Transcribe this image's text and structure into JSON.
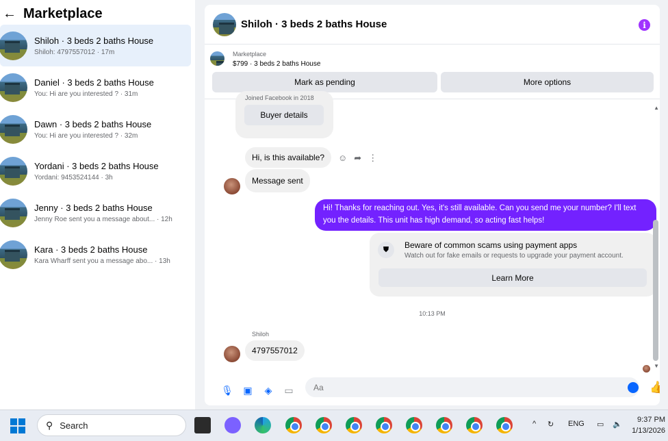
{
  "sidebar": {
    "title": "Marketplace",
    "conversations": [
      {
        "title": "Shiloh · 3 beds 2 baths House",
        "preview": "Shiloh: 4797557012 · 17m"
      },
      {
        "title": "Daniel · 3 beds 2 baths House",
        "preview": "You: Hi are you interested ? · 31m"
      },
      {
        "title": "Dawn · 3 beds 2 baths House",
        "preview": "You: Hi are you interested ? · 32m"
      },
      {
        "title": "Yordani · 3 beds 2 baths House",
        "preview": "Yordani: 9453524144 · 3h"
      },
      {
        "title": "Jenny · 3 beds 2 baths House",
        "preview": "Jenny Roe sent you a message about... · 12h"
      },
      {
        "title": "Kara · 3 beds 2 baths House",
        "preview": "Kara Wharff sent you a message abo... · 13h"
      }
    ]
  },
  "chat": {
    "title": "Shiloh · 3 beds 2 baths House",
    "listing_label": "Marketplace",
    "listing_price": "$799 · 3 beds 2 baths House",
    "mark_pending": "Mark as pending",
    "more_options": "More options",
    "joined": "Joined Facebook in 2018",
    "buyer_details": "Buyer details",
    "msg_available": "Hi, is this available?",
    "msg_sent": "Message sent",
    "msg_reply": "Hi! Thanks for reaching out. Yes, it's still available. Can you send me your number? I'll text you the details. This unit has high demand, so acting fast helps!",
    "scam_title": "Beware of common scams using payment apps",
    "scam_sub": "Watch out for fake emails or requests to upgrade your payment account.",
    "learn_more": "Learn More",
    "timestamp": "10:13 PM",
    "sender": "Shiloh",
    "msg_number": "4797557012",
    "composer_placeholder": "Aa"
  },
  "taskbar": {
    "search": "Search",
    "lang": "ENG",
    "time": "9:37 PM",
    "date": "1/13/2026"
  }
}
